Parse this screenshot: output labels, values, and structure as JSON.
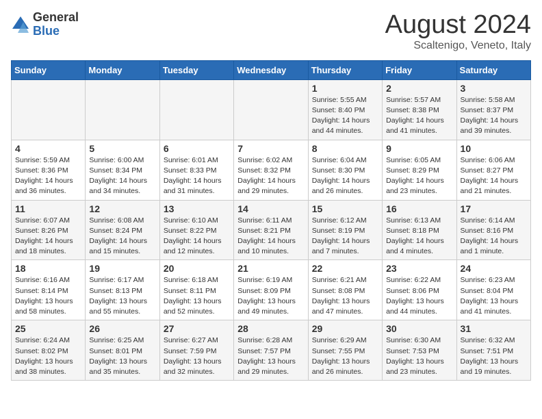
{
  "header": {
    "logo_general": "General",
    "logo_blue": "Blue",
    "month_title": "August 2024",
    "location": "Scaltenigo, Veneto, Italy"
  },
  "days_of_week": [
    "Sunday",
    "Monday",
    "Tuesday",
    "Wednesday",
    "Thursday",
    "Friday",
    "Saturday"
  ],
  "weeks": [
    [
      {
        "day": "",
        "info": ""
      },
      {
        "day": "",
        "info": ""
      },
      {
        "day": "",
        "info": ""
      },
      {
        "day": "",
        "info": ""
      },
      {
        "day": "1",
        "info": "Sunrise: 5:55 AM\nSunset: 8:40 PM\nDaylight: 14 hours\nand 44 minutes."
      },
      {
        "day": "2",
        "info": "Sunrise: 5:57 AM\nSunset: 8:38 PM\nDaylight: 14 hours\nand 41 minutes."
      },
      {
        "day": "3",
        "info": "Sunrise: 5:58 AM\nSunset: 8:37 PM\nDaylight: 14 hours\nand 39 minutes."
      }
    ],
    [
      {
        "day": "4",
        "info": "Sunrise: 5:59 AM\nSunset: 8:36 PM\nDaylight: 14 hours\nand 36 minutes."
      },
      {
        "day": "5",
        "info": "Sunrise: 6:00 AM\nSunset: 8:34 PM\nDaylight: 14 hours\nand 34 minutes."
      },
      {
        "day": "6",
        "info": "Sunrise: 6:01 AM\nSunset: 8:33 PM\nDaylight: 14 hours\nand 31 minutes."
      },
      {
        "day": "7",
        "info": "Sunrise: 6:02 AM\nSunset: 8:32 PM\nDaylight: 14 hours\nand 29 minutes."
      },
      {
        "day": "8",
        "info": "Sunrise: 6:04 AM\nSunset: 8:30 PM\nDaylight: 14 hours\nand 26 minutes."
      },
      {
        "day": "9",
        "info": "Sunrise: 6:05 AM\nSunset: 8:29 PM\nDaylight: 14 hours\nand 23 minutes."
      },
      {
        "day": "10",
        "info": "Sunrise: 6:06 AM\nSunset: 8:27 PM\nDaylight: 14 hours\nand 21 minutes."
      }
    ],
    [
      {
        "day": "11",
        "info": "Sunrise: 6:07 AM\nSunset: 8:26 PM\nDaylight: 14 hours\nand 18 minutes."
      },
      {
        "day": "12",
        "info": "Sunrise: 6:08 AM\nSunset: 8:24 PM\nDaylight: 14 hours\nand 15 minutes."
      },
      {
        "day": "13",
        "info": "Sunrise: 6:10 AM\nSunset: 8:22 PM\nDaylight: 14 hours\nand 12 minutes."
      },
      {
        "day": "14",
        "info": "Sunrise: 6:11 AM\nSunset: 8:21 PM\nDaylight: 14 hours\nand 10 minutes."
      },
      {
        "day": "15",
        "info": "Sunrise: 6:12 AM\nSunset: 8:19 PM\nDaylight: 14 hours\nand 7 minutes."
      },
      {
        "day": "16",
        "info": "Sunrise: 6:13 AM\nSunset: 8:18 PM\nDaylight: 14 hours\nand 4 minutes."
      },
      {
        "day": "17",
        "info": "Sunrise: 6:14 AM\nSunset: 8:16 PM\nDaylight: 14 hours\nand 1 minute."
      }
    ],
    [
      {
        "day": "18",
        "info": "Sunrise: 6:16 AM\nSunset: 8:14 PM\nDaylight: 13 hours\nand 58 minutes."
      },
      {
        "day": "19",
        "info": "Sunrise: 6:17 AM\nSunset: 8:13 PM\nDaylight: 13 hours\nand 55 minutes."
      },
      {
        "day": "20",
        "info": "Sunrise: 6:18 AM\nSunset: 8:11 PM\nDaylight: 13 hours\nand 52 minutes."
      },
      {
        "day": "21",
        "info": "Sunrise: 6:19 AM\nSunset: 8:09 PM\nDaylight: 13 hours\nand 49 minutes."
      },
      {
        "day": "22",
        "info": "Sunrise: 6:21 AM\nSunset: 8:08 PM\nDaylight: 13 hours\nand 47 minutes."
      },
      {
        "day": "23",
        "info": "Sunrise: 6:22 AM\nSunset: 8:06 PM\nDaylight: 13 hours\nand 44 minutes."
      },
      {
        "day": "24",
        "info": "Sunrise: 6:23 AM\nSunset: 8:04 PM\nDaylight: 13 hours\nand 41 minutes."
      }
    ],
    [
      {
        "day": "25",
        "info": "Sunrise: 6:24 AM\nSunset: 8:02 PM\nDaylight: 13 hours\nand 38 minutes."
      },
      {
        "day": "26",
        "info": "Sunrise: 6:25 AM\nSunset: 8:01 PM\nDaylight: 13 hours\nand 35 minutes."
      },
      {
        "day": "27",
        "info": "Sunrise: 6:27 AM\nSunset: 7:59 PM\nDaylight: 13 hours\nand 32 minutes."
      },
      {
        "day": "28",
        "info": "Sunrise: 6:28 AM\nSunset: 7:57 PM\nDaylight: 13 hours\nand 29 minutes."
      },
      {
        "day": "29",
        "info": "Sunrise: 6:29 AM\nSunset: 7:55 PM\nDaylight: 13 hours\nand 26 minutes."
      },
      {
        "day": "30",
        "info": "Sunrise: 6:30 AM\nSunset: 7:53 PM\nDaylight: 13 hours\nand 23 minutes."
      },
      {
        "day": "31",
        "info": "Sunrise: 6:32 AM\nSunset: 7:51 PM\nDaylight: 13 hours\nand 19 minutes."
      }
    ]
  ]
}
